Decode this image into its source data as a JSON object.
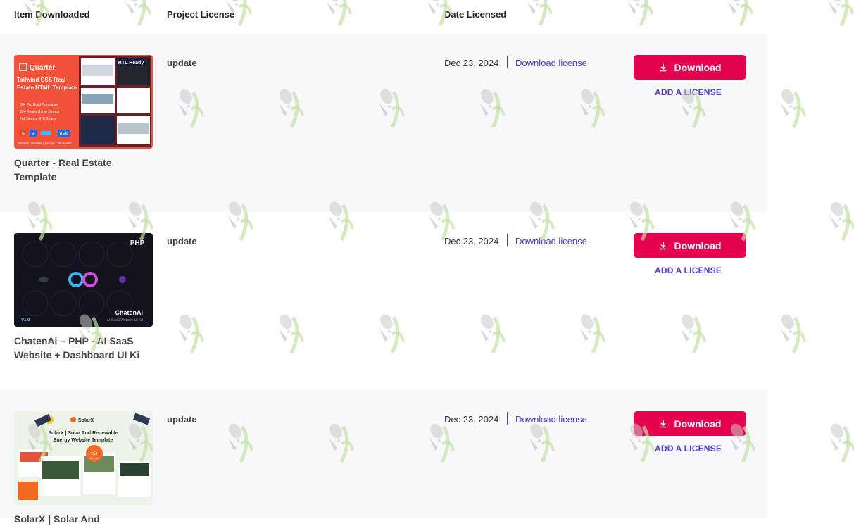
{
  "header": {
    "col_item": "Item Downloaded",
    "col_license": "Project License",
    "col_date": "Date Licensed"
  },
  "colors": {
    "accent_button": "#e5024f",
    "link": "#4a3fc9",
    "row_alt_bg": "#f8f8fb"
  },
  "rows": [
    {
      "title": "Quarter - Real Estate Template",
      "license": "update",
      "date": "Dec 23, 2024",
      "download_license": "Download license",
      "download": "Download",
      "add_license": "ADD A LICENSE",
      "thumb": {
        "brand": "Quarter",
        "badge": "RTL Ready",
        "headline": "Tailwind CSS Real Estate HTML Template",
        "bullets": [
          "80+ Pro Build Templates",
          "22+ Ready Home Demos",
          "Full Demos RTL Ready"
        ],
        "stack": [
          "5",
          "3",
          "BEM"
        ],
        "footer": "Fastest | Flexible | Unique | Minimalist"
      }
    },
    {
      "title": "ChatenAi – PHP - AI SaaS Website + Dashboard UI Ki",
      "license": "update",
      "date": "Dec 23, 2024",
      "download_license": "Download license",
      "download": "Download",
      "add_license": "ADD A LICENSE",
      "thumb": {
        "badge": "PHP",
        "brand": "ChatenAI",
        "tagline": "AI SaaS Website UI Kit",
        "version": "V1.0"
      }
    },
    {
      "title": "SolarX | Solar And",
      "license": "update",
      "date": "Dec 23, 2024",
      "download_license": "Download license",
      "download": "Download",
      "add_license": "ADD A LICENSE",
      "thumb": {
        "brand": "SolarX",
        "headline_a": "SolarX | Solar And Renewable",
        "headline_b": "Energy Website Template",
        "badge": "15+",
        "badge_sub": "Demos"
      }
    }
  ]
}
